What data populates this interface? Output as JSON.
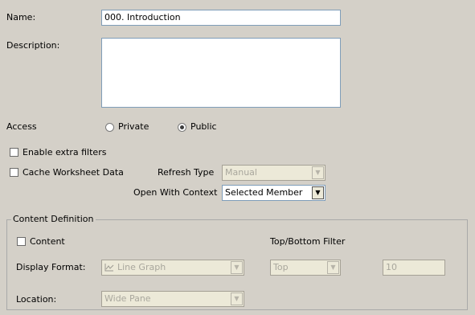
{
  "form": {
    "name_label": "Name:",
    "name_value": "000. Introduction",
    "description_label": "Description:",
    "description_value": "",
    "access_label": "Access",
    "access_options": [
      {
        "label": "Private",
        "selected": false
      },
      {
        "label": "Public",
        "selected": true
      }
    ],
    "enable_extra_filters": {
      "label": "Enable extra filters",
      "checked": false
    },
    "cache_worksheet_data": {
      "label": "Cache Worksheet Data",
      "checked": false
    },
    "refresh_type": {
      "label": "Refresh Type",
      "value": "Manual",
      "enabled": false
    },
    "open_with_context": {
      "label": "Open With Context",
      "value": "Selected Member",
      "enabled": true
    }
  },
  "content_definition": {
    "legend": "Content Definition",
    "content_checkbox": {
      "label": "Content",
      "checked": false
    },
    "top_bottom_filter_label": "Top/Bottom Filter",
    "display_format": {
      "label": "Display Format:",
      "value": "Line Graph",
      "icon": "line-graph-icon",
      "enabled": false
    },
    "top_bottom_select": {
      "value": "Top",
      "enabled": false
    },
    "top_bottom_count": {
      "value": "10",
      "enabled": false
    },
    "location": {
      "label": "Location:",
      "value": "Wide Pane",
      "enabled": false
    }
  },
  "colors": {
    "background": "#d4d0c8",
    "disabled_text": "#a9a79d",
    "input_border": "#7f9db9"
  }
}
